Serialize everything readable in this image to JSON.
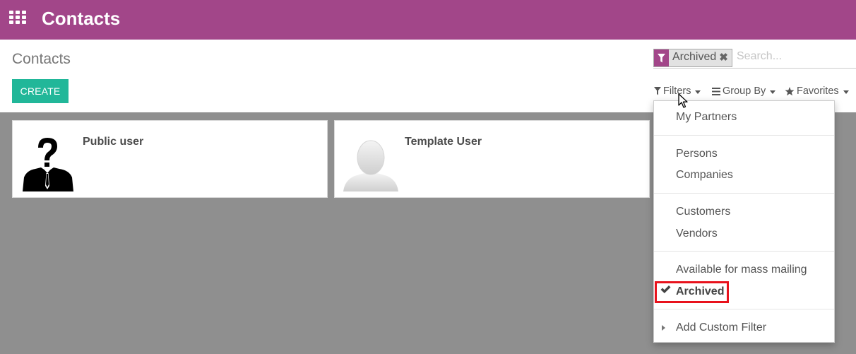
{
  "topbar": {
    "app_title": "Contacts"
  },
  "breadcrumb": "Contacts",
  "create_label": "CREATE",
  "search": {
    "facet_label": "Archived",
    "facet_remove": "✖",
    "placeholder": "Search..."
  },
  "view_controls": {
    "filters_label": "Filters",
    "groupby_label": "Group By",
    "favorites_label": "Favorites"
  },
  "cards": [
    {
      "name": "Public user"
    },
    {
      "name": "Template User"
    }
  ],
  "filters_menu": {
    "items": [
      {
        "label": "My Partners",
        "checked": false
      },
      {
        "label": "Persons",
        "checked": false
      },
      {
        "label": "Companies",
        "checked": false
      },
      {
        "label": "Customers",
        "checked": false
      },
      {
        "label": "Vendors",
        "checked": false
      },
      {
        "label": "Available for mass mailing",
        "checked": false
      },
      {
        "label": "Archived",
        "checked": true
      }
    ],
    "add_custom": "Add Custom Filter"
  },
  "colors": {
    "brand": "#a24689",
    "create": "#21b799",
    "highlight": "#e8121c"
  }
}
